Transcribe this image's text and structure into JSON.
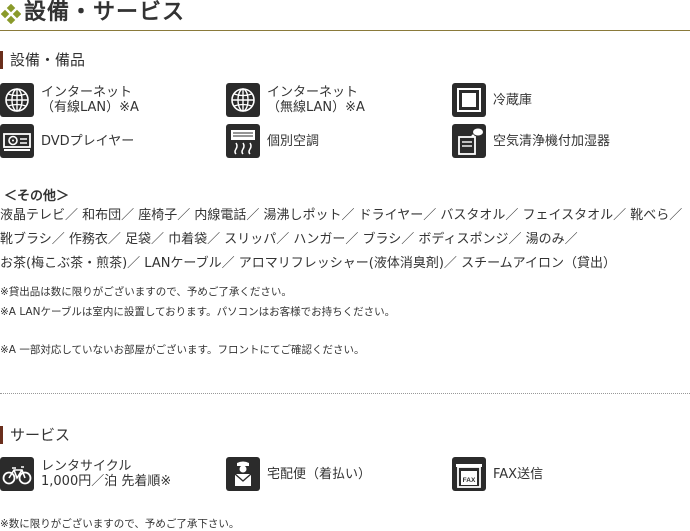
{
  "page_title": "設備・サービス",
  "colors": {
    "accent": "#8a9a2a",
    "heading_bar": "#6a2e1c",
    "icon_bg": "#2b2b2b",
    "title_rule": "#8a7a3a"
  },
  "equipment": {
    "heading": "設備・備品",
    "items": [
      {
        "icon": "globe-icon",
        "line1": "インターネット",
        "line2": "（有線LAN）※A"
      },
      {
        "icon": "globe-icon",
        "line1": "インターネット",
        "line2": "（無線LAN）※A"
      },
      {
        "icon": "refrigerator-icon",
        "line1": "冷蔵庫"
      },
      {
        "icon": "dvd-player-icon",
        "line1": "DVDプレイヤー"
      },
      {
        "icon": "air-conditioner-icon",
        "line1": "個別空調"
      },
      {
        "icon": "air-purifier-icon",
        "line1": "空気清浄機付加湿器"
      }
    ],
    "others_heading": "＜その他＞",
    "others_lines": [
      "液晶テレビ／ 和布団／ 座椅子／ 内線電話／ 湯沸しポット／ ドライヤー／ バスタオル／ フェイスタオル／ 靴べら／",
      "靴ブラシ／ 作務衣／ 足袋／ 巾着袋／ スリッパ／ ハンガー／ ブラシ／ ボディスポンジ／ 湯のみ／",
      "お茶(梅こぶ茶・煎茶)／ LANケーブル／ アロマリフレッシャー(液体消臭剤)／ スチームアイロン（貸出）"
    ],
    "notes": [
      "※貸出品は数に限りがございますので、予めご了承ください。",
      "※A LANケーブルは室内に設置しております。パソコンはお客様でお持ちください。",
      "※A 一部対応していないお部屋がございます。フロントにてご確認ください。"
    ]
  },
  "services": {
    "heading": "サービス",
    "items": [
      {
        "icon": "bicycle-icon",
        "line1": "レンタサイクル",
        "line2": "1,000円／泊 先着順※"
      },
      {
        "icon": "delivery-icon",
        "line1": "宅配便（着払い）"
      },
      {
        "icon": "fax-icon",
        "line1": "FAX送信"
      }
    ],
    "note": "※数に限りがございますので、予めご了承下さい。"
  }
}
